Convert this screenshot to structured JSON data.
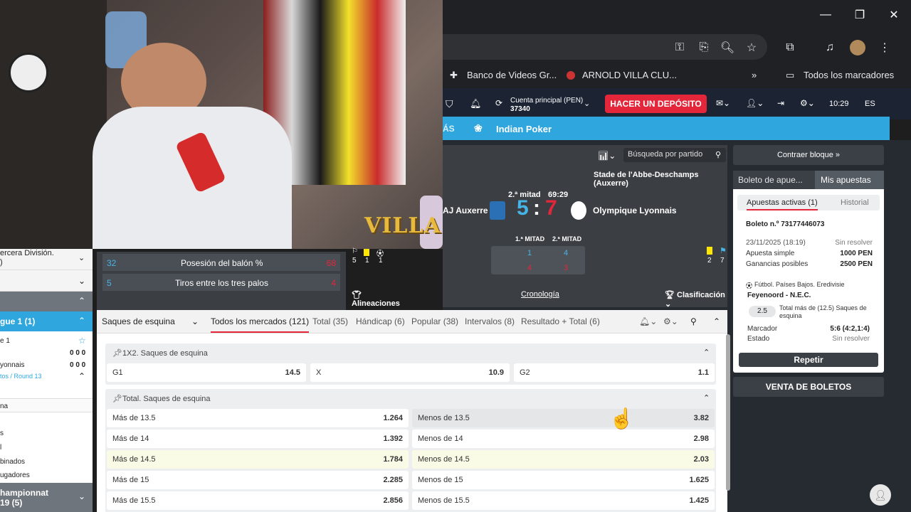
{
  "window": {
    "minimize": "—",
    "restore": "❐",
    "close": "✕"
  },
  "bookmarks": {
    "item1": "Banco de Videos Gr...",
    "item2": "ARNOLD VILLA CLU...",
    "more": "»",
    "all": "Todos los marcadores"
  },
  "header": {
    "account_label": "Cuenta principal (PEN)",
    "account_number": "37340",
    "deposit": "HACER UN DEPÓSITO",
    "time": "10:29",
    "lang": "ES"
  },
  "nav": {
    "item_partial": "ÁS",
    "item": "Indian Poker"
  },
  "search": {
    "placeholder": "Búsqueda por partido"
  },
  "sidebar_toggle": "Contraer bloque »",
  "match": {
    "stadium": "Stade de l'Abbe-Deschamps (Auxerre)",
    "period": "2.ª mitad",
    "clock": "69:29",
    "home": "AJ Auxerre",
    "away": "Olympique Lyonnais",
    "score_home": "5",
    "score_sep": ":",
    "score_away": "7",
    "half1": "1.ª MITAD",
    "half2": "2.ª MITAD",
    "h1_home": "1",
    "h2_home": "4",
    "h1_away": "4",
    "h2_away": "3",
    "left_stats": [
      "5",
      "1",
      "1"
    ],
    "right_stats": [
      "2",
      "7"
    ],
    "lineups": "Alineaciones",
    "timeline": "Cronología",
    "standings": "Clasificación"
  },
  "overlay": {
    "brand": "VILLA"
  },
  "stats": [
    {
      "left": "32",
      "label": "Posesión del balón %",
      "right": "68"
    },
    {
      "left": "5",
      "label": "Tiros entre los tres palos",
      "right": "4"
    }
  ],
  "left_panel": {
    "league1": "ercera División.",
    "league1b": ")",
    "league_active": "gue 1 (1)",
    "team_a": "e 1",
    "team_b": "yonnais",
    "score_a": "0 0 0",
    "score_b": "0 0 0",
    "round": "tos / Round 13",
    "items": [
      "na",
      "s",
      "l",
      "binados",
      "ugadores"
    ],
    "bottom": "hampionnat",
    "bottom2": "19 (5)"
  },
  "markets": {
    "category": "Saques de esquina",
    "tabs": [
      "Todos los mercados (121)",
      "Total (35)",
      "Hándicap (6)",
      "Popular (38)",
      "Intervalos (8)",
      "Resultado + Total (6)"
    ],
    "group1": {
      "title": "1X2. Saques de esquina",
      "cells": [
        {
          "label": "G1",
          "odd": "14.5"
        },
        {
          "label": "X",
          "odd": "10.9"
        },
        {
          "label": "G2",
          "odd": "1.1"
        }
      ]
    },
    "group2": {
      "title": "Total. Saques de esquina",
      "rows": [
        {
          "over": "Más de 13.5",
          "over_odd": "1.264",
          "under": "Menos de 13.5",
          "under_odd": "3.82"
        },
        {
          "over": "Más de 14",
          "over_odd": "1.392",
          "under": "Menos de 14",
          "under_odd": "2.98"
        },
        {
          "over": "Más de 14.5",
          "over_odd": "1.784",
          "under": "Menos de 14.5",
          "under_odd": "2.03"
        },
        {
          "over": "Más de 15",
          "over_odd": "2.285",
          "under": "Menos de 15",
          "under_odd": "1.625"
        },
        {
          "over": "Más de 15.5",
          "over_odd": "2.856",
          "under": "Menos de 15.5",
          "under_odd": "1.425"
        }
      ]
    }
  },
  "betslip": {
    "tab1": "Boleto de apue...",
    "tab2": "Mis apuestas",
    "sub1": "Apuestas activas (1)",
    "sub2": "Historial",
    "ticket": "Boleto n.º 73177446073",
    "date": "23/11/2025 (18:19)",
    "status_unresolved": "Sin resolver",
    "type": "Apuesta simple",
    "stake": "1000 PEN",
    "gain_label": "Ganancias posibles",
    "gain": "2500 PEN",
    "league": "Fútbol. Países Bajos. Eredivisie",
    "event": "Feyenoord - N.E.C.",
    "odd": "2.5",
    "market": "Total más de (12.5) Saques de esquina",
    "score_label": "Marcador",
    "score": "5:6 (4:2,1:4)",
    "state_label": "Estado",
    "state": "Sin resolver",
    "repeat": "Repetir"
  },
  "venta": "VENTA DE BOLETOS"
}
